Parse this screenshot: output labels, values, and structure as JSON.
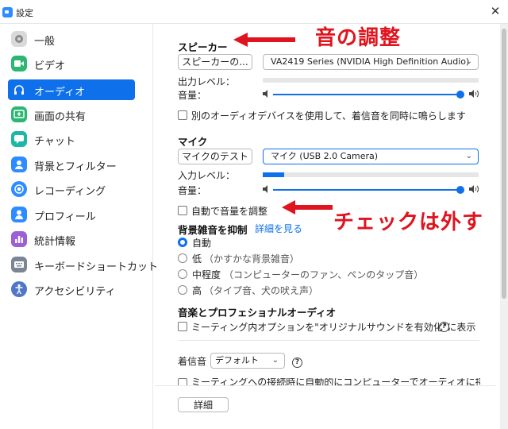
{
  "window": {
    "title": "設定"
  },
  "sidebar": {
    "items": [
      {
        "label": "一般",
        "icon": "gear-icon",
        "color": "#9e9e9e"
      },
      {
        "label": "ビデオ",
        "icon": "video-camera-icon",
        "color": "#2bb673"
      },
      {
        "label": "オーディオ",
        "icon": "headphones-icon",
        "color": "#ffffff",
        "active": true
      },
      {
        "label": "画面の共有",
        "icon": "share-screen-icon",
        "color": "#2bb673"
      },
      {
        "label": "チャット",
        "icon": "chat-bubble-icon",
        "color": "#1eb7a6"
      },
      {
        "label": "背景とフィルター",
        "icon": "person-background-icon",
        "color": "#2d8cff"
      },
      {
        "label": "レコーディング",
        "icon": "record-icon",
        "color": "#2d8cff"
      },
      {
        "label": "プロフィール",
        "icon": "profile-icon",
        "color": "#2d8cff"
      },
      {
        "label": "統計情報",
        "icon": "bar-stats-icon",
        "color": "#9c5fd6"
      },
      {
        "label": "キーボードショートカット",
        "icon": "keyboard-icon",
        "color": "#7b8593"
      },
      {
        "label": "アクセシビリティ",
        "icon": "accessibility-icon",
        "color": "#4f76c9"
      }
    ]
  },
  "speaker": {
    "heading": "スピーカー",
    "test_button": "スピーカーの...",
    "device": "VA2419 Series (NVIDIA High Definition Audio)",
    "output_level_label": "出力レベル：",
    "output_level": 0,
    "volume_label": "音量：",
    "volume": 1.0,
    "separate_device_label": "別のオーディオデバイスを使用して、着信音を同時に鳴らします"
  },
  "mic": {
    "heading": "マイク",
    "test_button": "マイクのテスト",
    "device": "マイク (USB 2.0 Camera)",
    "input_level_label": "入力レベル：",
    "input_level": 0.1,
    "volume_label": "音量：",
    "volume": 1.0,
    "auto_adjust_label": "自動で音量を調整"
  },
  "noise": {
    "heading": "背景雑音を抑制",
    "detail_link": "詳細を見る",
    "options": [
      {
        "label": "自動",
        "hint": "",
        "selected": true
      },
      {
        "label": "低",
        "hint": "（かすかな背景雑音）",
        "selected": false
      },
      {
        "label": "中程度",
        "hint": "（コンピューターのファン、ペンのタップ音）",
        "selected": false
      },
      {
        "label": "高",
        "hint": "（タイプ音、犬の吠え声）",
        "selected": false
      }
    ]
  },
  "pro_audio": {
    "heading": "音楽とプロフェショナルオーディオ",
    "original_sound_label": "ミーティング内オプションを\"オリジナルサウンドを有効化\"に表示"
  },
  "ringtone": {
    "label": "着信音",
    "value": "デフォルト",
    "join_label": "ミーティングへの接続時に自動的にコンピューターでオーディオに接続"
  },
  "footer": {
    "detail_button": "詳細"
  },
  "annotations": {
    "volume_note": "音の調整",
    "uncheck_note": "チェックは外す",
    "color": "#e0141e"
  }
}
